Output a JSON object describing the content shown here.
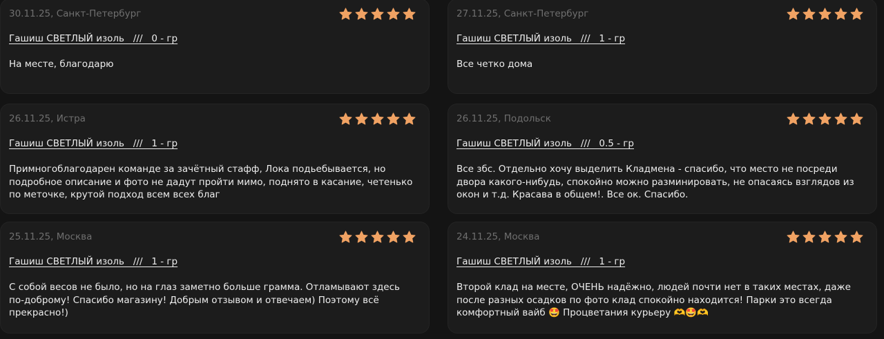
{
  "colors": {
    "background": "#141414",
    "card": "#1c1c1c",
    "star": "#f0a263",
    "meta_text": "#6f6f6f",
    "body_text": "#ededed"
  },
  "reviews": [
    {
      "date_city": "30.11.25, Санкт-Петербург",
      "rating": 5,
      "product": "Гашиш СВЕТЛЫЙ изоль   ///   0 - гр",
      "text": "На месте, благодарю"
    },
    {
      "date_city": "27.11.25, Санкт-Петербург",
      "rating": 5,
      "product": "Гашиш СВЕТЛЫЙ изоль   ///   1 - гр",
      "text": "Все четко дома"
    },
    {
      "date_city": "26.11.25, Истра",
      "rating": 5,
      "product": "Гашиш СВЕТЛЫЙ изоль   ///   1 - гр",
      "text": "Примногоблагодарен команде за зачётный стафф, Лока подьебывается, но подробное описание и фото не дадут пройти мимо, поднято в касание, четенько по меточке, крутой подход всем всех благ"
    },
    {
      "date_city": "26.11.25, Подольск",
      "rating": 5,
      "product": "Гашиш СВЕТЛЫЙ изоль   ///   0.5 - гр",
      "text": "Все збс. Отдельно хочу выделить Кладмена - спасибо, что место не посреди двора какого-нибудь, спокойно можно разминировать, не опасаясь взглядов из окон и т.д. Красава в общем!. Все ок. Спасибо."
    },
    {
      "date_city": "25.11.25, Москва",
      "rating": 5,
      "product": "Гашиш СВЕТЛЫЙ изоль   ///   1 - гр",
      "text": "С собой весов не было, но на глаз заметно больше грамма. Отламывают здесь по-доброму! Спасибо магазину! Добрым отзывом и отвечаем) Поэтому всё прекрасно!)"
    },
    {
      "date_city": "24.11.25, Москва",
      "rating": 5,
      "product": "Гашиш СВЕТЛЫЙ изоль   ///   1 - гр",
      "text": "Второй клад на месте, ОЧЕНЬ надёжно, людей почти нет в таких местах, даже после разных осадков по фото клад спокойно находится! Парки это всегда комфортный вайб 🤩 Процветания курьеру 🫶🤩🫶"
    }
  ]
}
